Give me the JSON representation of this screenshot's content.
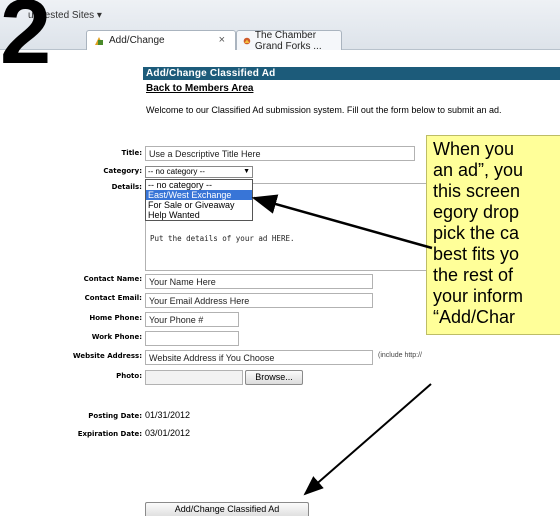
{
  "step_number": "2",
  "browser": {
    "suggested_sites": "uggested Sites ▾",
    "tabs": [
      {
        "label": "Add/Change"
      },
      {
        "label": "The Chamber Grand Forks ..."
      }
    ],
    "close_glyph": "×"
  },
  "page": {
    "header": "Add/Change Classified Ad",
    "back_link": "Back to Members Area",
    "welcome": "Welcome to our Classified Ad submission system. Fill out the form below to submit an ad."
  },
  "form": {
    "title_label": "Title:",
    "title_value": "Use a Descriptive Title Here",
    "category_label": "Category:",
    "category_value": "-- no category --",
    "category_options": [
      "-- no category --",
      "East/West Exchange",
      "For Sale or Giveaway",
      "Help Wanted"
    ],
    "category_highlighted": "East/West Exchange",
    "details_label": "Details:",
    "details_value": "Put the details of your ad HERE.",
    "contact_name_label": "Contact Name:",
    "contact_name_value": "Your Name Here",
    "contact_email_label": "Contact Email:",
    "contact_email_value": "Your Email Address Here",
    "home_phone_label": "Home Phone:",
    "home_phone_value": "Your Phone #",
    "work_phone_label": "Work Phone:",
    "work_phone_value": "",
    "website_label": "Website Address:",
    "website_value": "Website Address if You Choose",
    "website_hint": "(include http://",
    "photo_label": "Photo:",
    "browse_label": "Browse...",
    "posting_date_label": "Posting Date:",
    "posting_date_value": "01/31/2012",
    "expiration_date_label": "Expiration Date:",
    "expiration_date_value": "03/01/2012",
    "submit_label": "Add/Change Classified Ad"
  },
  "callout": {
    "lines": [
      "When you",
      "an ad”, you",
      "this screen",
      "egory drop",
      "pick the ca",
      "best fits yo",
      "the rest of",
      "your inform",
      "“Add/Char"
    ]
  },
  "colors": {
    "header_bg": "#1c5b7a",
    "callout_bg": "#ffff99",
    "highlight": "#3875d7"
  }
}
